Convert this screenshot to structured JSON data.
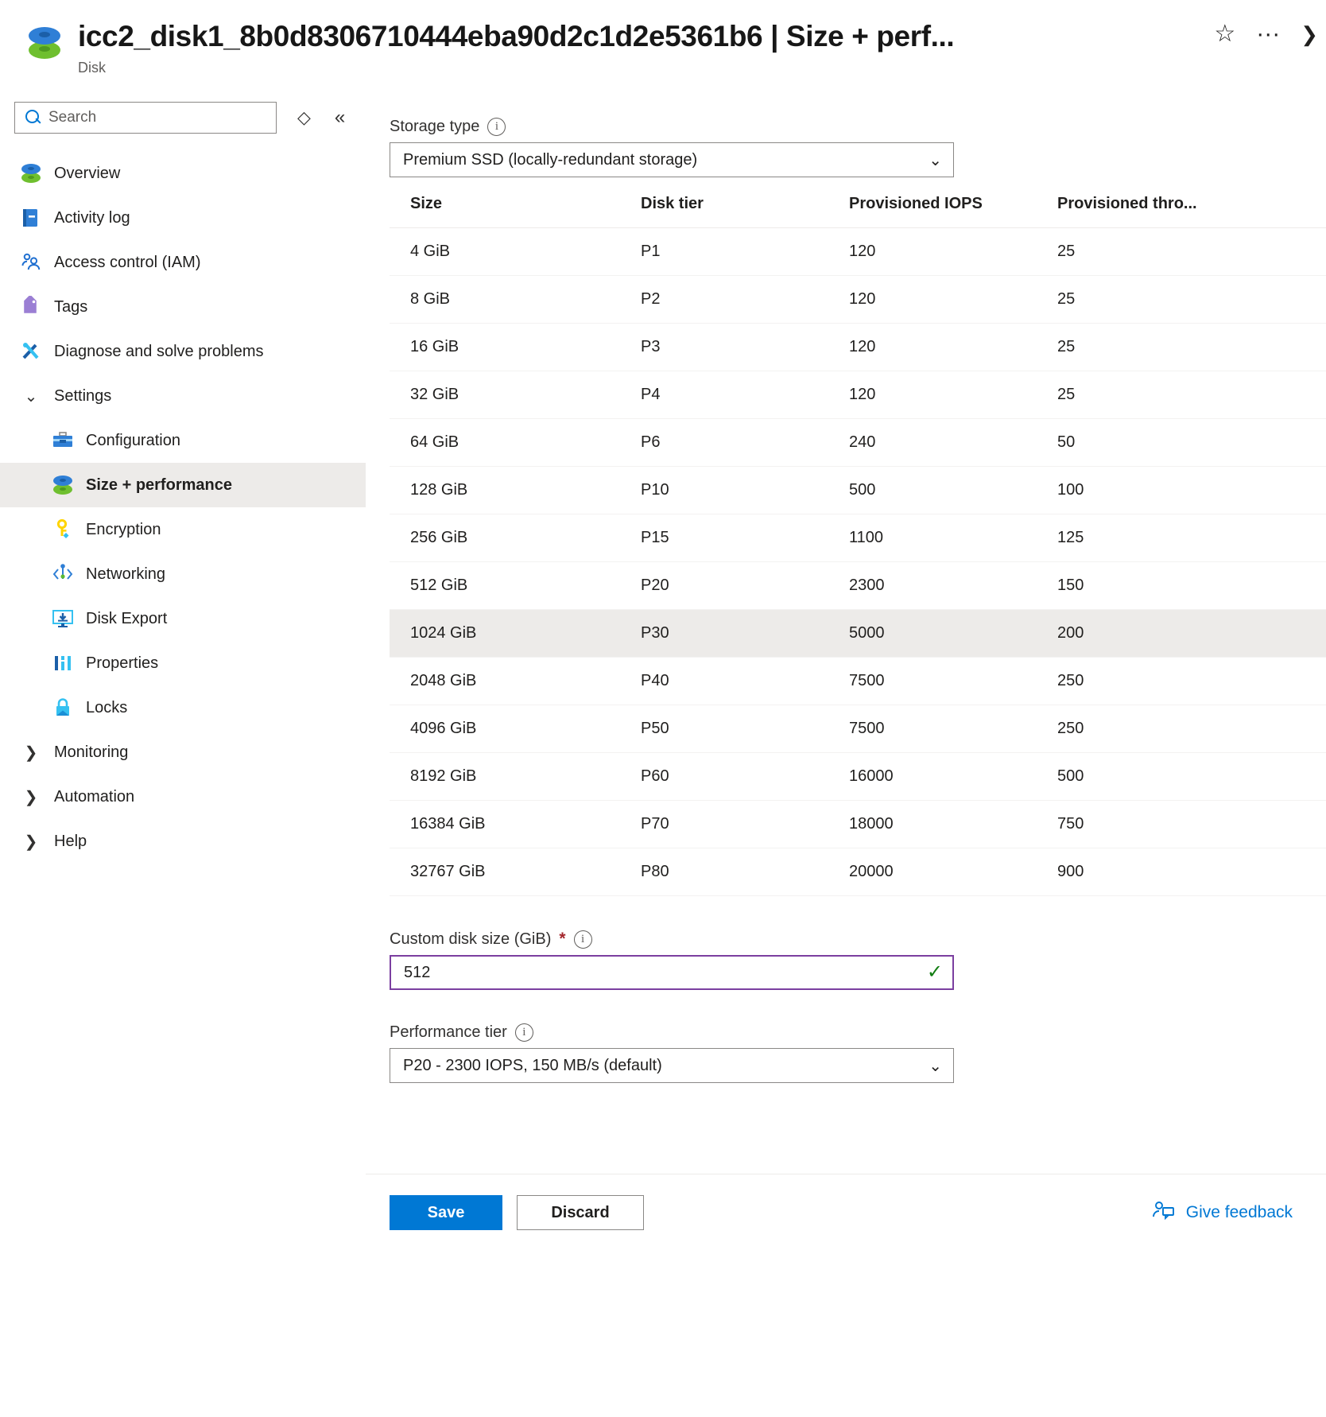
{
  "header": {
    "title": "icc2_disk1_8b0d8306710444eba90d2c1d2e5361b6 | Size + perf...",
    "subtitle": "Disk",
    "logo_icon": "disk-icon",
    "favorite_icon": "star-outline-icon",
    "more_icon": "ellipsis-icon",
    "close_icon": "chevron-right-icon"
  },
  "sidebar": {
    "search": {
      "placeholder": "Search",
      "value": "",
      "icon": "search-icon"
    },
    "sort_icon": "sort-icon",
    "collapse_icon": "double-chevron-left-icon",
    "items": [
      {
        "label": "Overview",
        "icon": "disk-icon",
        "level": "top",
        "selected": false
      },
      {
        "label": "Activity log",
        "icon": "activity-log-icon",
        "level": "top",
        "selected": false
      },
      {
        "label": "Access control (IAM)",
        "icon": "people-icon",
        "level": "top",
        "selected": false
      },
      {
        "label": "Tags",
        "icon": "tag-icon",
        "level": "top",
        "selected": false
      },
      {
        "label": "Diagnose and solve problems",
        "icon": "tools-icon",
        "level": "top",
        "selected": false
      },
      {
        "label": "Settings",
        "icon": "chevron-down-icon",
        "level": "group",
        "selected": false
      },
      {
        "label": "Configuration",
        "icon": "toolbox-icon",
        "level": "child",
        "selected": false
      },
      {
        "label": "Size + performance",
        "icon": "disk-icon",
        "level": "child",
        "selected": true
      },
      {
        "label": "Encryption",
        "icon": "key-icon",
        "level": "child",
        "selected": false
      },
      {
        "label": "Networking",
        "icon": "networking-icon",
        "level": "child",
        "selected": false
      },
      {
        "label": "Disk Export",
        "icon": "disk-export-icon",
        "level": "child",
        "selected": false
      },
      {
        "label": "Properties",
        "icon": "properties-icon",
        "level": "child",
        "selected": false
      },
      {
        "label": "Locks",
        "icon": "lock-icon",
        "level": "child",
        "selected": false
      },
      {
        "label": "Monitoring",
        "icon": "chevron-right-icon",
        "level": "group",
        "selected": false
      },
      {
        "label": "Automation",
        "icon": "chevron-right-icon",
        "level": "group",
        "selected": false
      },
      {
        "label": "Help",
        "icon": "chevron-right-icon",
        "level": "group",
        "selected": false
      }
    ]
  },
  "main": {
    "storage_type": {
      "label": "Storage type",
      "info_icon": "info-icon",
      "value": "Premium SSD (locally-redundant storage)",
      "chevron_icon": "chevron-down-icon"
    },
    "table": {
      "columns": [
        "Size",
        "Disk tier",
        "Provisioned IOPS",
        "Provisioned thro..."
      ],
      "selected_row_index": 8,
      "rows": [
        [
          "4 GiB",
          "P1",
          "120",
          "25"
        ],
        [
          "8 GiB",
          "P2",
          "120",
          "25"
        ],
        [
          "16 GiB",
          "P3",
          "120",
          "25"
        ],
        [
          "32 GiB",
          "P4",
          "120",
          "25"
        ],
        [
          "64 GiB",
          "P6",
          "240",
          "50"
        ],
        [
          "128 GiB",
          "P10",
          "500",
          "100"
        ],
        [
          "256 GiB",
          "P15",
          "1100",
          "125"
        ],
        [
          "512 GiB",
          "P20",
          "2300",
          "150"
        ],
        [
          "1024 GiB",
          "P30",
          "5000",
          "200"
        ],
        [
          "2048 GiB",
          "P40",
          "7500",
          "250"
        ],
        [
          "4096 GiB",
          "P50",
          "7500",
          "250"
        ],
        [
          "8192 GiB",
          "P60",
          "16000",
          "500"
        ],
        [
          "16384 GiB",
          "P70",
          "18000",
          "750"
        ],
        [
          "32767 GiB",
          "P80",
          "20000",
          "900"
        ]
      ]
    },
    "custom_disk_size": {
      "label": "Custom disk size (GiB)",
      "required_marker": "*",
      "info_icon": "info-icon",
      "value": "512",
      "valid_icon": "checkmark-icon",
      "valid_glyph": "✓"
    },
    "performance_tier": {
      "label": "Performance tier",
      "info_icon": "info-icon",
      "value": "P20 - 2300 IOPS, 150 MB/s (default)",
      "chevron_icon": "chevron-down-icon"
    }
  },
  "footer": {
    "save_label": "Save",
    "discard_label": "Discard",
    "feedback_label": "Give feedback",
    "feedback_icon": "person-feedback-icon"
  },
  "colors": {
    "accent": "#0078d4",
    "focus_border": "#7B3FA0",
    "valid_green": "#107c10",
    "required_red": "#a4262c",
    "selected_row": "#edebe9"
  }
}
